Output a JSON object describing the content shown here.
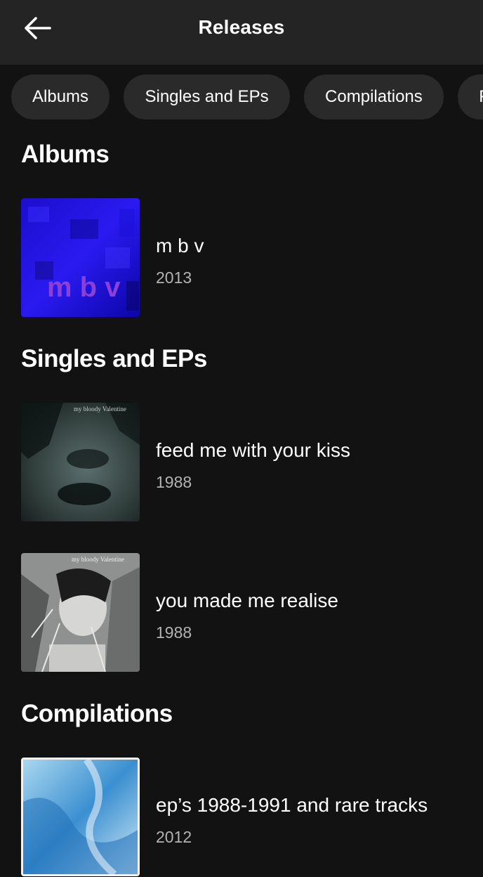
{
  "header": {
    "title": "Releases",
    "back_icon": "arrow-left-icon"
  },
  "chips": [
    {
      "label": "Albums"
    },
    {
      "label": "Singles and EPs"
    },
    {
      "label": "Compilations"
    },
    {
      "label": "Featuring"
    }
  ],
  "sections": {
    "albums": {
      "title": "Albums",
      "items": [
        {
          "name": "m b v",
          "year": "2013"
        }
      ]
    },
    "singles": {
      "title": "Singles and EPs",
      "items": [
        {
          "name": "feed me with your kiss",
          "year": "1988"
        },
        {
          "name": "you made me realise",
          "year": "1988"
        }
      ]
    },
    "compilations": {
      "title": "Compilations",
      "items": [
        {
          "name": "ep’s 1988-1991 and rare tracks",
          "year": "2012"
        }
      ]
    }
  },
  "covers": {
    "mbv_text": "m b v",
    "band_text": "my bloody Valentine"
  },
  "colors": {
    "background": "#121212",
    "topbar": "#242424",
    "chip": "#2a2a2a",
    "secondary_text": "#b3b3b3"
  }
}
